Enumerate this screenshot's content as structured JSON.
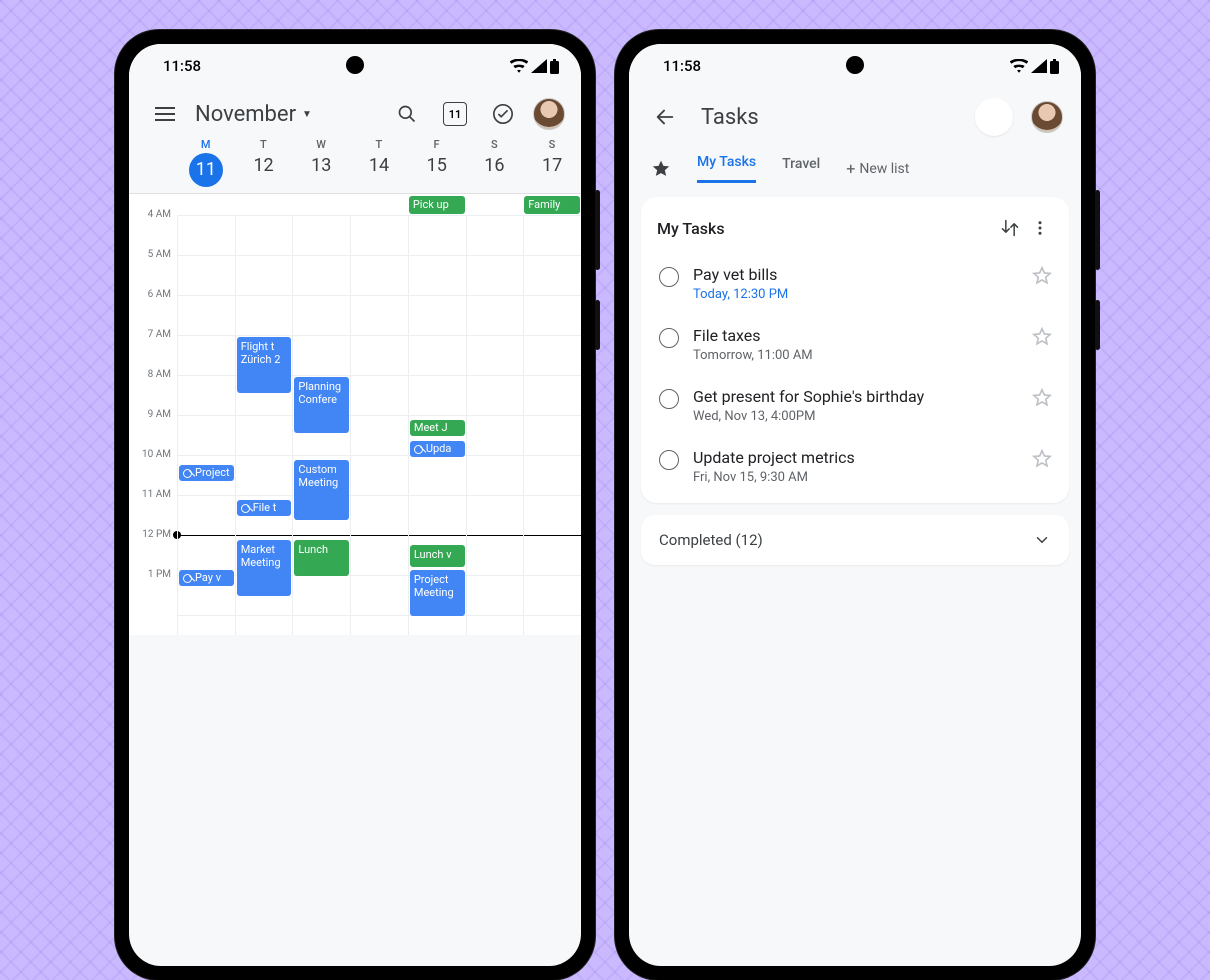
{
  "statusbar": {
    "time": "11:58"
  },
  "calendar": {
    "month_label": "November",
    "today_day_number": "11",
    "dows": [
      "M",
      "T",
      "W",
      "T",
      "F",
      "S",
      "S"
    ],
    "days": [
      "11",
      "12",
      "13",
      "14",
      "15",
      "16",
      "17"
    ],
    "active_index": 0,
    "hour_labels": [
      "4 AM",
      "5 AM",
      "6 AM",
      "7 AM",
      "8 AM",
      "9 AM",
      "10 AM",
      "11 AM",
      "12 PM",
      "1 PM"
    ],
    "allday": {
      "fri": "Pick up",
      "sun": "Family"
    },
    "events": {
      "flight": "Flight t Zürich 2",
      "planning": "Planning Confere",
      "custom": "Custom Meeting",
      "market": "Market Meeting",
      "lunch_w": "Lunch",
      "lunch_f": "Lunch v",
      "project_f": "Project Meeting",
      "meet_j": "Meet J",
      "project_chip": "Project",
      "update_chip": "Upda",
      "file_chip": "File t",
      "pay_chip": "Pay v"
    }
  },
  "tasks": {
    "title": "Tasks",
    "tabs": {
      "my_tasks": "My Tasks",
      "travel": "Travel",
      "new_list": "New list"
    },
    "list_title": "My Tasks",
    "items": [
      {
        "title": "Pay vet bills",
        "sub": "Today, 12:30 PM",
        "due": true
      },
      {
        "title": "File taxes",
        "sub": "Tomorrow, 11:00 AM",
        "due": false
      },
      {
        "title": "Get present for Sophie's birthday",
        "sub": "Wed, Nov 13, 4:00PM",
        "due": false
      },
      {
        "title": "Update project metrics",
        "sub": "Fri, Nov 15, 9:30 AM",
        "due": false
      }
    ],
    "completed_label": "Completed (12)"
  }
}
